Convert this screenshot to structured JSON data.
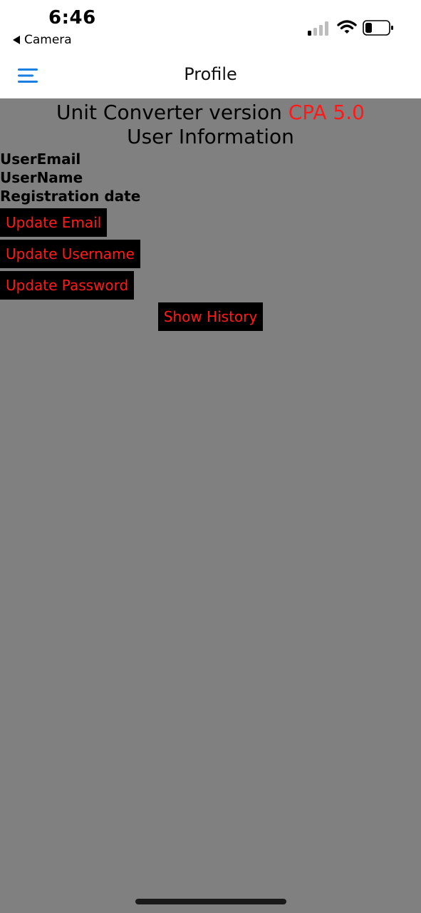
{
  "status_bar": {
    "time": "6:46",
    "back_app": "Camera",
    "icons": [
      "signal-icon",
      "wifi-icon",
      "battery-icon"
    ]
  },
  "header": {
    "title": "Profile",
    "menu_icon": "hamburger-menu-icon",
    "accent_color": "#1a7fe0"
  },
  "main": {
    "app_title_prefix": "Unit Converter version",
    "app_version": "CPA 5.0",
    "section_title": "User Information",
    "fields": {
      "email_label": "UserEmail",
      "username_label": "UserName",
      "registration_label": "Registration date"
    },
    "buttons": {
      "update_email": "Update Email",
      "update_username": "Update Username",
      "update_password": "Update Password",
      "show_history": "Show History"
    }
  },
  "colors": {
    "background": "#808080",
    "button_bg": "#000000",
    "button_text": "#ff1a1a",
    "version_text": "#ff1a1a"
  }
}
